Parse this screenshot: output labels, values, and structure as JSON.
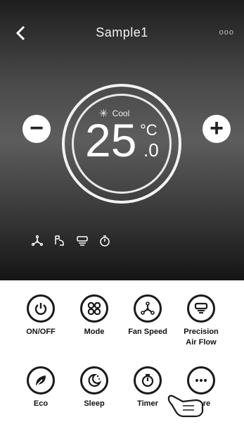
{
  "header": {
    "back_icon": "back-chevron-icon",
    "title": "Sample1",
    "more": "ooo"
  },
  "thermostat": {
    "mode_icon": "snowflake-icon",
    "mode": "Cool",
    "temperature": "25",
    "unit": "°C",
    "decimal": ".0",
    "minus_label": "−",
    "plus_label": "+"
  },
  "status_icons": [
    "fan-icon",
    "swing-icon",
    "airflow-icon",
    "timer-icon"
  ],
  "controls": [
    {
      "label": "ON/OFF",
      "icon": "power-icon"
    },
    {
      "label": "Mode",
      "icon": "mode-icon"
    },
    {
      "label": "Fan Speed",
      "icon": "fan-icon"
    },
    {
      "label": "Precision Air Flow",
      "icon": "airflow-icon"
    },
    {
      "label": "Eco",
      "icon": "eco-leaf-icon"
    },
    {
      "label": "Sleep",
      "icon": "sleep-moon-icon"
    },
    {
      "label": "Timer",
      "icon": "timer-icon"
    },
    {
      "label": "More",
      "icon": "more-icon"
    }
  ]
}
